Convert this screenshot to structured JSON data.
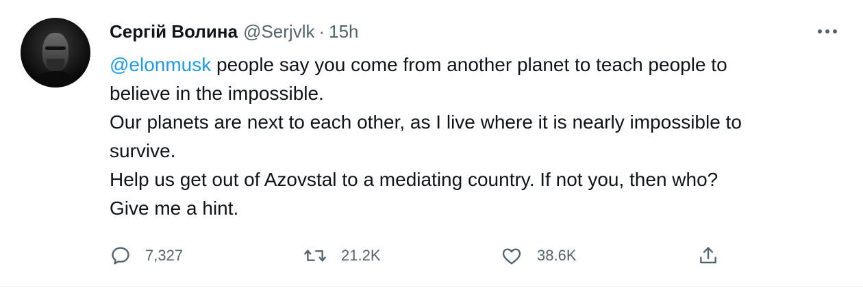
{
  "tweet": {
    "author": {
      "display_name": "Сергій Волина",
      "handle": "@Serjvlk",
      "separator": "·",
      "time": "15h"
    },
    "text": {
      "mention": "@elonmusk",
      "line1_rest": " people say you come from another planet to teach people to",
      "line2": "believe in the impossible.",
      "line3": "Our planets are next to each other, as I live where it is nearly impossible to",
      "line4": "survive.",
      "line5": "Help us get out of Azovstal to a mediating country. If not you, then who?",
      "line6": "Give me a hint."
    },
    "actions": {
      "reply": {
        "icon": "reply-icon",
        "count": "7,327"
      },
      "retweet": {
        "icon": "retweet-icon",
        "count": "21.2K"
      },
      "like": {
        "icon": "heart-icon",
        "count": "38.6K"
      },
      "share": {
        "icon": "share-icon"
      }
    },
    "more_icon": "more-icon"
  },
  "colors": {
    "accent": "#1d9bf0",
    "secondary_text": "#536471",
    "primary_text": "#0f1419",
    "divider": "#e6ecf0"
  }
}
